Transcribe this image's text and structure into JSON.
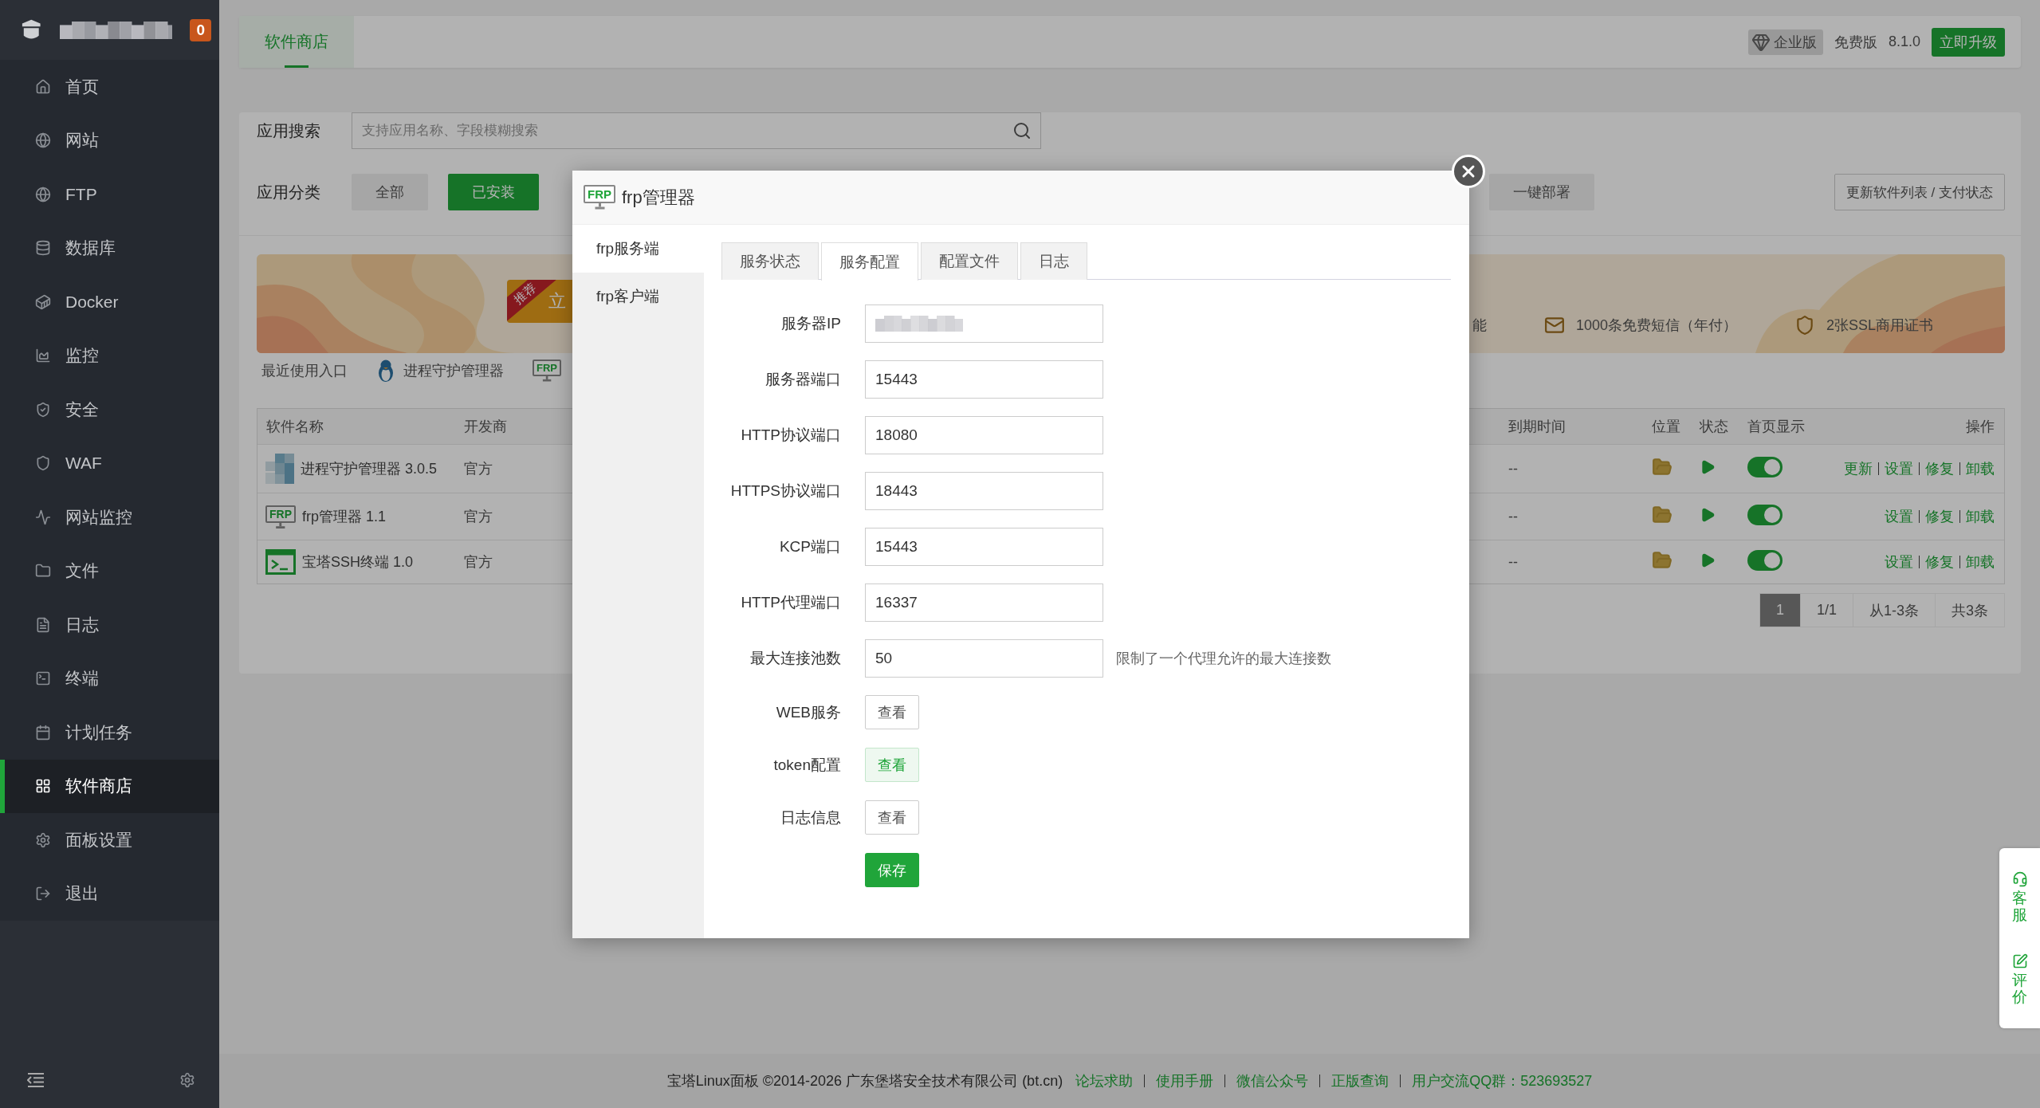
{
  "sidebar": {
    "badge": "0",
    "items": [
      {
        "label": "首页",
        "selected": false
      },
      {
        "label": "网站",
        "selected": false
      },
      {
        "label": "FTP",
        "selected": false
      },
      {
        "label": "数据库",
        "selected": false
      },
      {
        "label": "Docker",
        "selected": false
      },
      {
        "label": "监控",
        "selected": false
      },
      {
        "label": "安全",
        "selected": false
      },
      {
        "label": "WAF",
        "selected": false
      },
      {
        "label": "网站监控",
        "selected": false
      },
      {
        "label": "文件",
        "selected": false
      },
      {
        "label": "日志",
        "selected": false
      },
      {
        "label": "终端",
        "selected": false
      },
      {
        "label": "计划任务",
        "selected": false
      },
      {
        "label": "软件商店",
        "selected": true
      },
      {
        "label": "面板设置",
        "selected": false
      },
      {
        "label": "退出",
        "selected": false
      }
    ]
  },
  "top_bar": {
    "tab": {
      "label": "软件商店",
      "selected": true
    },
    "edition_badge": "企业版",
    "edition": "免费版",
    "version": "8.1.0",
    "upgrade_button": "立即升级"
  },
  "search": {
    "label": "应用搜索",
    "placeholder": "支持应用名称、字段模糊搜索"
  },
  "categories": {
    "label": "应用分类",
    "buttons": [
      {
        "label": "全部",
        "selected": false
      },
      {
        "label": "已安装",
        "selected": true
      }
    ],
    "deploy_button": "一键部署",
    "refresh_button": "更新软件列表 / 支付状态"
  },
  "banner": {
    "ribbon": "推荐",
    "cta": "立",
    "features": [
      "能",
      "1000条免费短信（年付）",
      "2张SSL商用证书"
    ]
  },
  "recent": {
    "label": "最近使用入口",
    "items": [
      {
        "label": "进程守护管理器"
      },
      {
        "icon_text": "FRP"
      }
    ]
  },
  "table": {
    "columns": [
      "软件名称",
      "开发商",
      "到期时间",
      "位置",
      "状态",
      "首页显示",
      "操作"
    ],
    "rows": [
      {
        "name": "进程守护管理器 3.0.5",
        "developer": "官方",
        "expiry": "--",
        "home_display": true,
        "actions": [
          "更新",
          "设置",
          "修复",
          "卸载"
        ]
      },
      {
        "name": "frp管理器 1.1",
        "icon_text": "FRP",
        "developer": "官方",
        "expiry": "--",
        "home_display": true,
        "actions": [
          "设置",
          "修复",
          "卸载"
        ]
      },
      {
        "name": "宝塔SSH终端 1.0",
        "developer": "官方",
        "expiry": "--",
        "home_display": true,
        "actions": [
          "设置",
          "修复",
          "卸载"
        ]
      }
    ]
  },
  "pagination": {
    "pages": [
      {
        "label": "1",
        "selected": true
      }
    ],
    "page_info": "1/1",
    "range": "从1-3条",
    "total": "共3条"
  },
  "footer": {
    "copyright": "宝塔Linux面板 ©2014-2026 广东堡塔安全技术有限公司 (bt.cn)",
    "links": [
      "论坛求助",
      "使用手册",
      "微信公众号",
      "正版查询",
      "用户交流QQ群：523693527"
    ]
  },
  "float_panel": [
    "客服",
    "评价"
  ],
  "modal": {
    "icon_text": "FRP",
    "title": "frp管理器",
    "nav": [
      {
        "label": "frp服务端",
        "selected": true
      },
      {
        "label": "frp客户端",
        "selected": false
      }
    ],
    "tabs": [
      {
        "label": "服务状态",
        "selected": false
      },
      {
        "label": "服务配置",
        "selected": true
      },
      {
        "label": "配置文件",
        "selected": false
      },
      {
        "label": "日志",
        "selected": false
      }
    ],
    "fields": [
      {
        "kind": "masked",
        "label": "服务器IP"
      },
      {
        "kind": "input",
        "label": "服务器端口",
        "value": "15443"
      },
      {
        "kind": "input",
        "label": "HTTP协议端口",
        "value": "18080"
      },
      {
        "kind": "input",
        "label": "HTTPS协议端口",
        "value": "18443"
      },
      {
        "kind": "input",
        "label": "KCP端口",
        "value": "15443"
      },
      {
        "kind": "input",
        "label": "HTTP代理端口",
        "value": "16337"
      },
      {
        "kind": "input",
        "label": "最大连接池数",
        "value": "50",
        "note": "限制了一个代理允许的最大连接数"
      },
      {
        "kind": "button",
        "label": "WEB服务",
        "button": "查看",
        "highlighted": false
      },
      {
        "kind": "button",
        "label": "token配置",
        "button": "查看",
        "highlighted": true
      },
      {
        "kind": "button",
        "label": "日志信息",
        "button": "查看",
        "highlighted": false
      }
    ],
    "save_button": "保存"
  }
}
